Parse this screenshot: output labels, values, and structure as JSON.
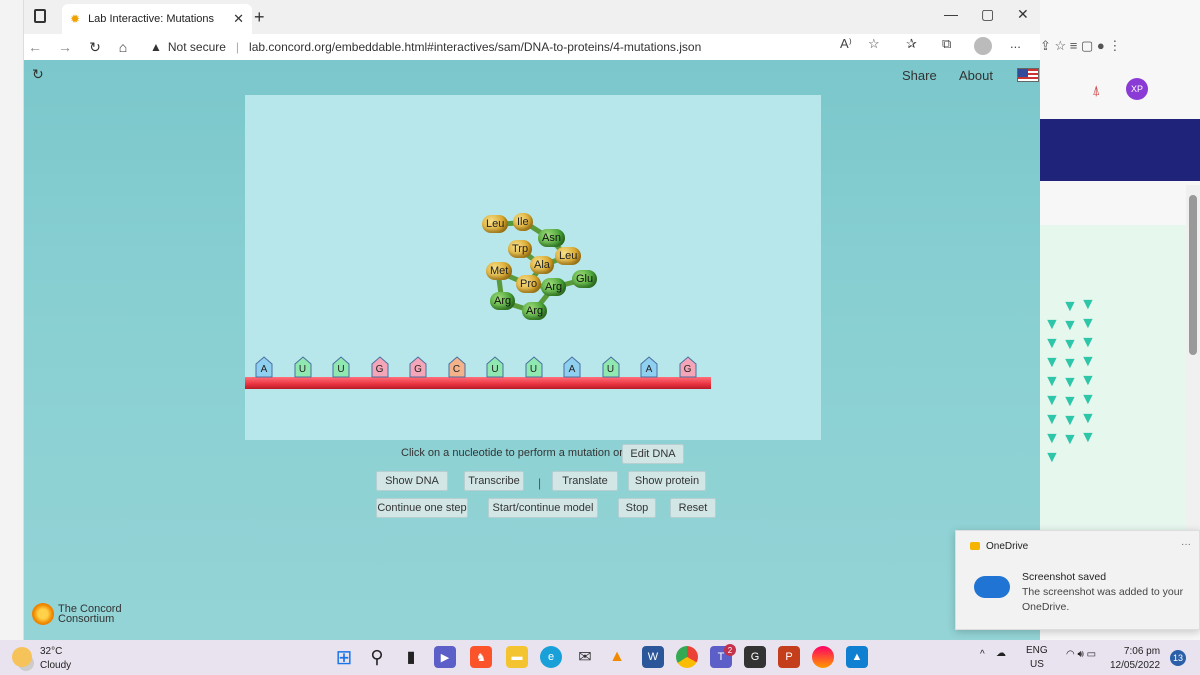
{
  "browser": {
    "tab_title": "Lab Interactive: Mutations",
    "url_warning": "Not secure",
    "url": "lab.concord.org/embeddable.html#interactives/sam/DNA-to-proteins/4-mutations.json",
    "read_aloud_icon": "A⁾",
    "more_menu": "..."
  },
  "page": {
    "share_label": "Share",
    "about_label": "About",
    "instruction": "Click on a nucleotide to perform a mutation or",
    "edit_dna_label": "Edit DNA",
    "buttons_row1": {
      "show_dna": "Show DNA",
      "transcribe": "Transcribe",
      "separator": "|",
      "translate": "Translate",
      "show_protein": "Show protein"
    },
    "buttons_row2": {
      "continue_one_step": "Continue one step",
      "start_continue": "Start/continue model",
      "stop": "Stop",
      "reset": "Reset"
    },
    "logo_text_line1": "The Concord",
    "logo_text_line2": "Consortium"
  },
  "model": {
    "nucleotides": [
      {
        "base": "A",
        "color": "#8fd0f0"
      },
      {
        "base": "U",
        "color": "#8fe8b0"
      },
      {
        "base": "U",
        "color": "#8fe8b0"
      },
      {
        "base": "G",
        "color": "#f4a6b8"
      },
      {
        "base": "G",
        "color": "#f4a6b8"
      },
      {
        "base": "C",
        "color": "#f4b28a"
      },
      {
        "base": "U",
        "color": "#8fe8b0"
      },
      {
        "base": "U",
        "color": "#8fe8b0"
      },
      {
        "base": "A",
        "color": "#8fd0f0"
      },
      {
        "base": "U",
        "color": "#8fe8b0"
      },
      {
        "base": "A",
        "color": "#8fd0f0"
      },
      {
        "base": "G",
        "color": "#f4a6b8"
      }
    ],
    "amino_acids": [
      {
        "name": "Leu",
        "type": "y"
      },
      {
        "name": "Ile",
        "type": "y"
      },
      {
        "name": "Asn",
        "type": "g"
      },
      {
        "name": "Trp",
        "type": "y"
      },
      {
        "name": "Leu",
        "type": "y"
      },
      {
        "name": "Ala",
        "type": "y"
      },
      {
        "name": "Met",
        "type": "y"
      },
      {
        "name": "Glu",
        "type": "g"
      },
      {
        "name": "Pro",
        "type": "y"
      },
      {
        "name": "Arg",
        "type": "g"
      },
      {
        "name": "Arg",
        "type": "g"
      },
      {
        "name": "Arg",
        "type": "g"
      }
    ]
  },
  "right_window": {
    "xp_badge": "XP"
  },
  "notification": {
    "app": "OneDrive",
    "title": "Screenshot saved",
    "message": "The screenshot was added to your OneDrive."
  },
  "taskbar": {
    "temperature": "32°C",
    "condition": "Cloudy",
    "language": "ENG",
    "region": "US",
    "time": "7:06 pm",
    "date": "12/05/2022",
    "notification_count": "13",
    "teams_badge": "2"
  }
}
